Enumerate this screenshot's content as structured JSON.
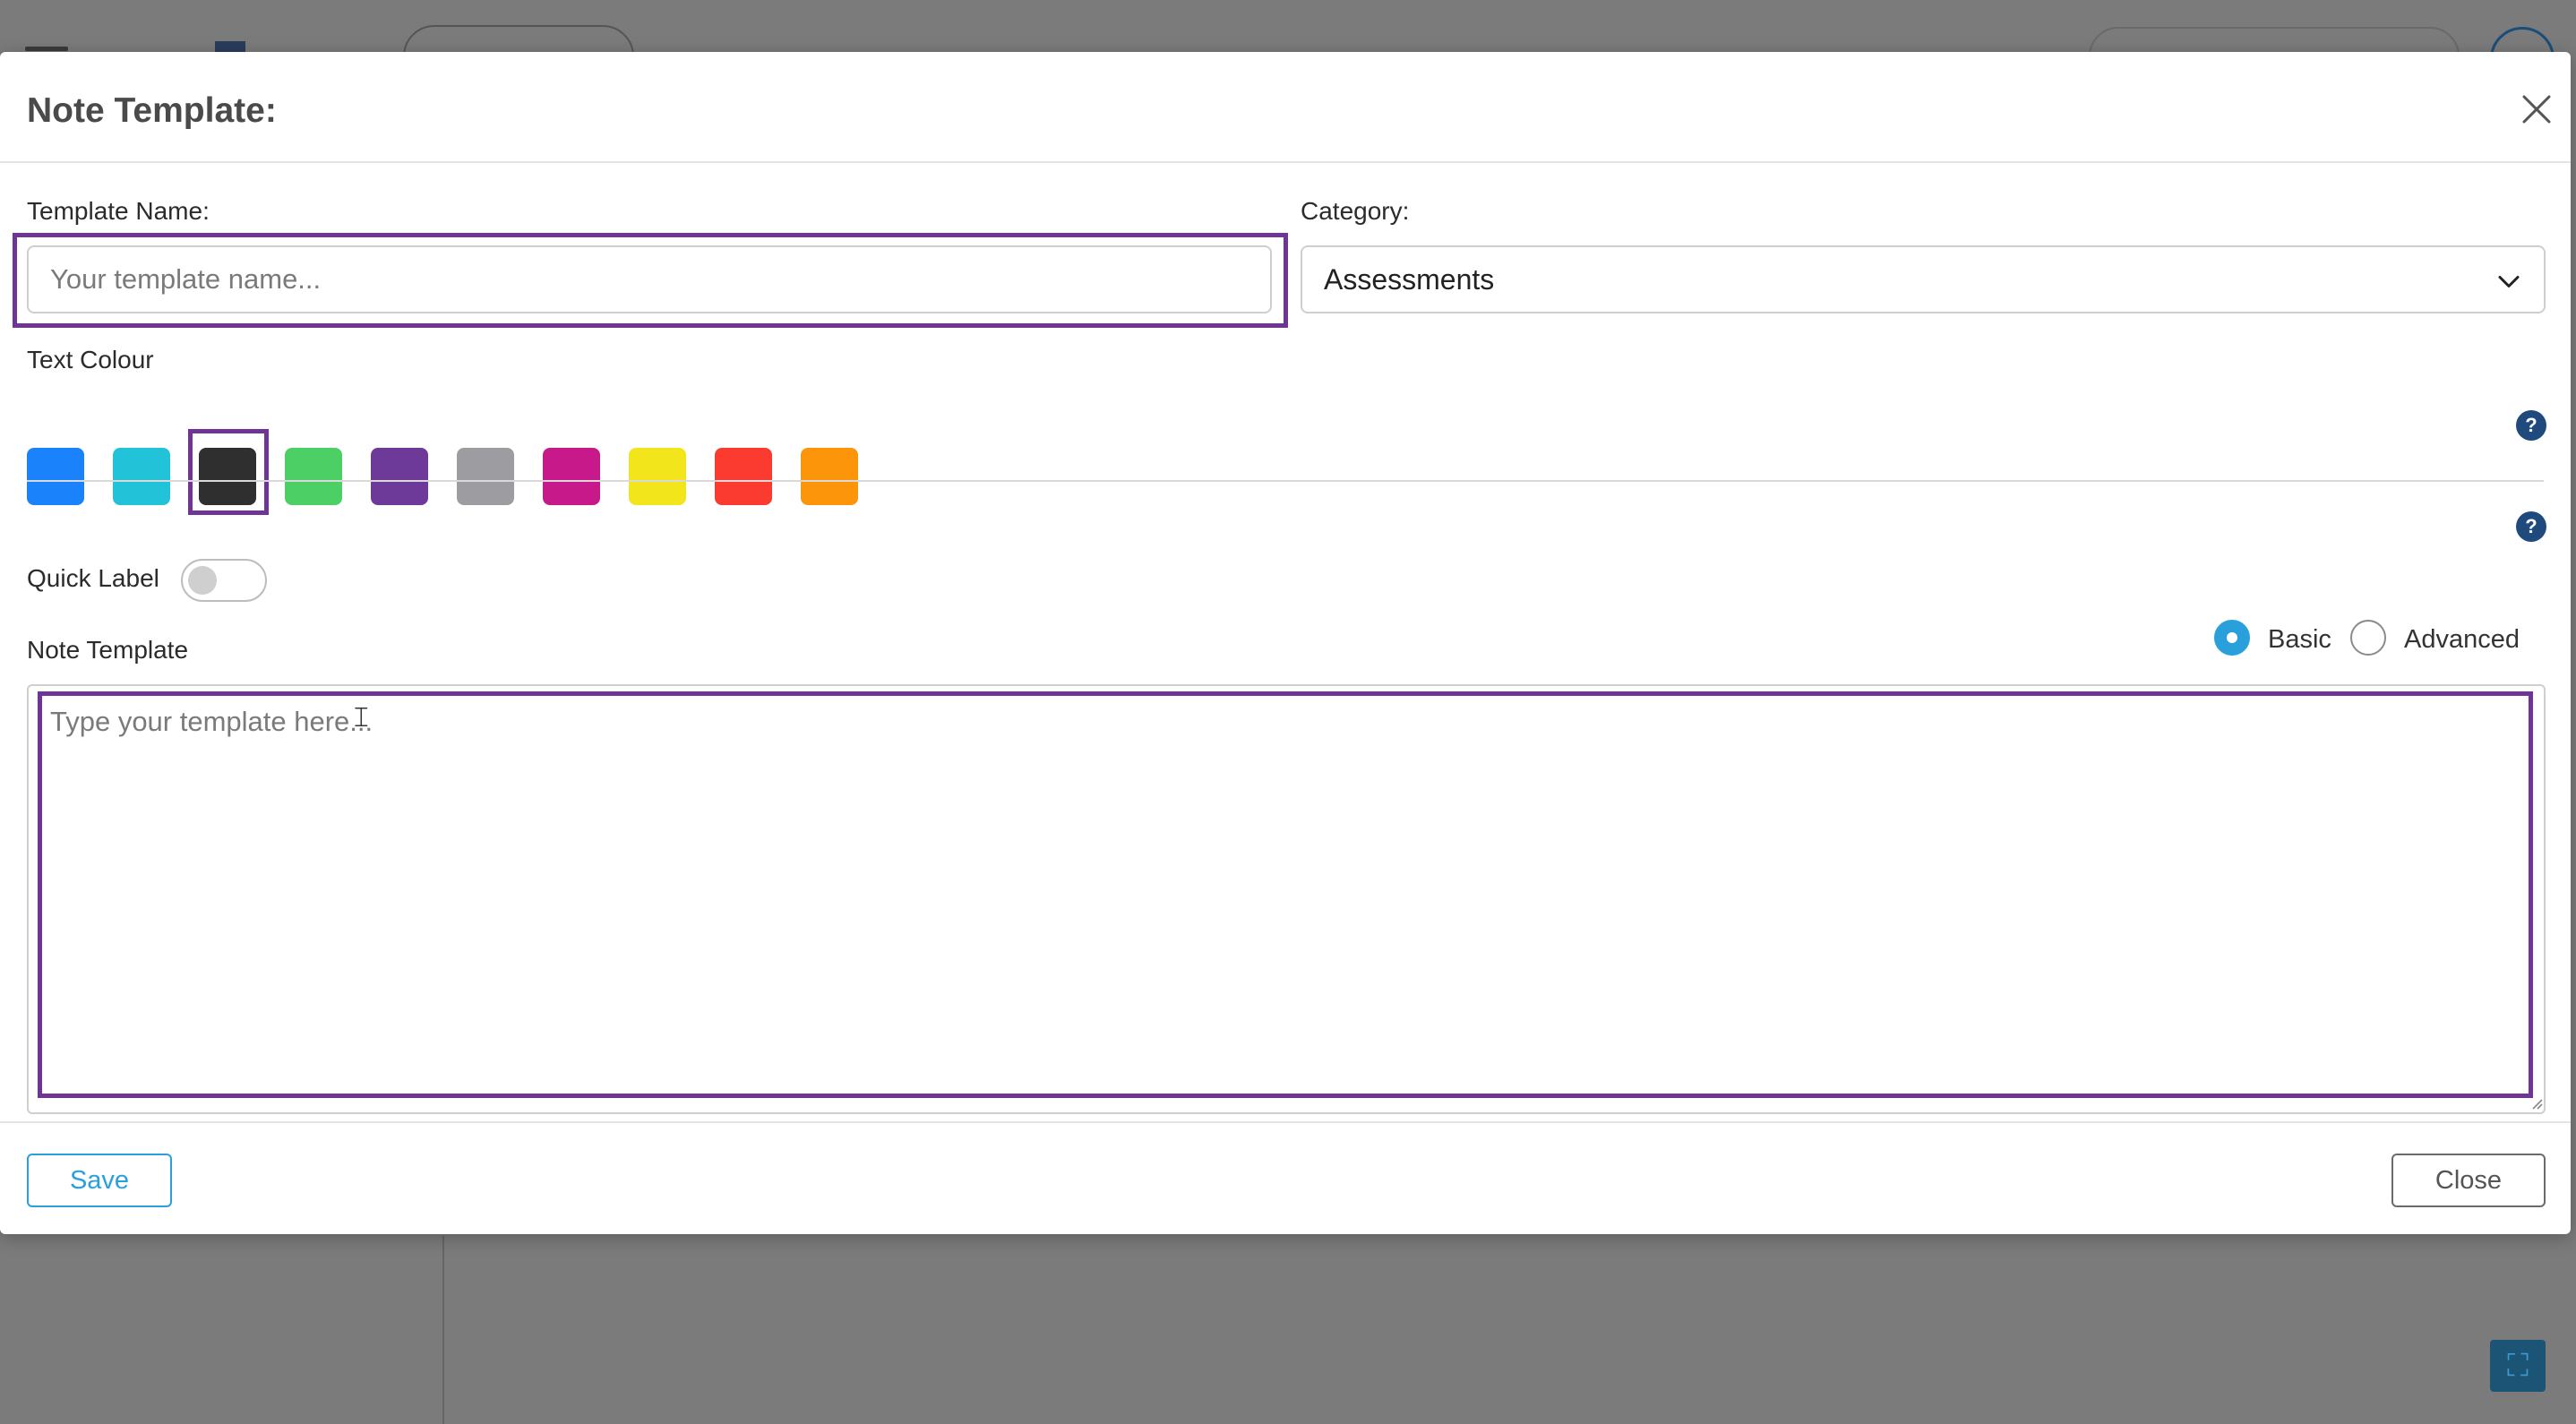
{
  "modal": {
    "title": "Note Template:",
    "template_name": {
      "label": "Template Name:",
      "placeholder": "Your template name...",
      "value": ""
    },
    "category": {
      "label": "Category:",
      "selected": "Assessments"
    },
    "text_colour": {
      "label": "Text Colour",
      "selected_index": 2,
      "swatches": [
        "#1a82fb",
        "#22c3d8",
        "#2f2f2f",
        "#4cd065",
        "#6e3a9a",
        "#9c9ca1",
        "#c8198a",
        "#f2e51b",
        "#fb3b2f",
        "#fd950b"
      ]
    },
    "quick_label": {
      "label": "Quick Label",
      "enabled": false
    },
    "note_template": {
      "label": "Note Template",
      "mode_options": [
        "Basic",
        "Advanced"
      ],
      "selected_mode": "Basic",
      "placeholder": "Type your template here...",
      "value": ""
    },
    "help_icon": "?",
    "save_label": "Save",
    "close_label": "Close"
  },
  "colors": {
    "accent": "#29a0dc",
    "highlight": "#6e3595",
    "help": "#1f4a7e"
  }
}
